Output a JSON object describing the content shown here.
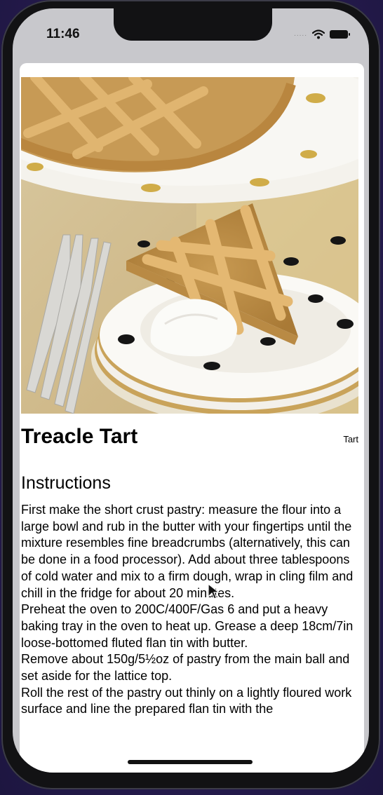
{
  "status_bar": {
    "time": "11:46",
    "signal_dots": "....."
  },
  "recipe": {
    "title": "Treacle Tart",
    "category": "Tart",
    "instructions_heading": "Instructions",
    "instructions_text": "First make the short crust pastry: measure the flour into a large bowl and rub in the butter with your fingertips until the mixture resembles fine breadcrumbs (alternatively, this can be done in a food processor). Add about three tablespoons of cold water and mix to a firm dough, wrap in cling film and chill in the fridge for about 20 minutes.\nPreheat the oven to 200C/400F/Gas 6 and put a heavy baking tray in the oven to heat up. Grease a deep 18cm/7in loose-bottomed fluted flan tin with butter.\nRemove about 150g/5½oz of pastry from the main ball and set aside for the lattice top.\nRoll the rest of the pastry out thinly on a lightly floured work surface and line the prepared flan tin with the"
  },
  "icons": {
    "wifi": "wifi-icon",
    "battery": "battery-icon",
    "cursor": "mouse-pointer-icon"
  }
}
